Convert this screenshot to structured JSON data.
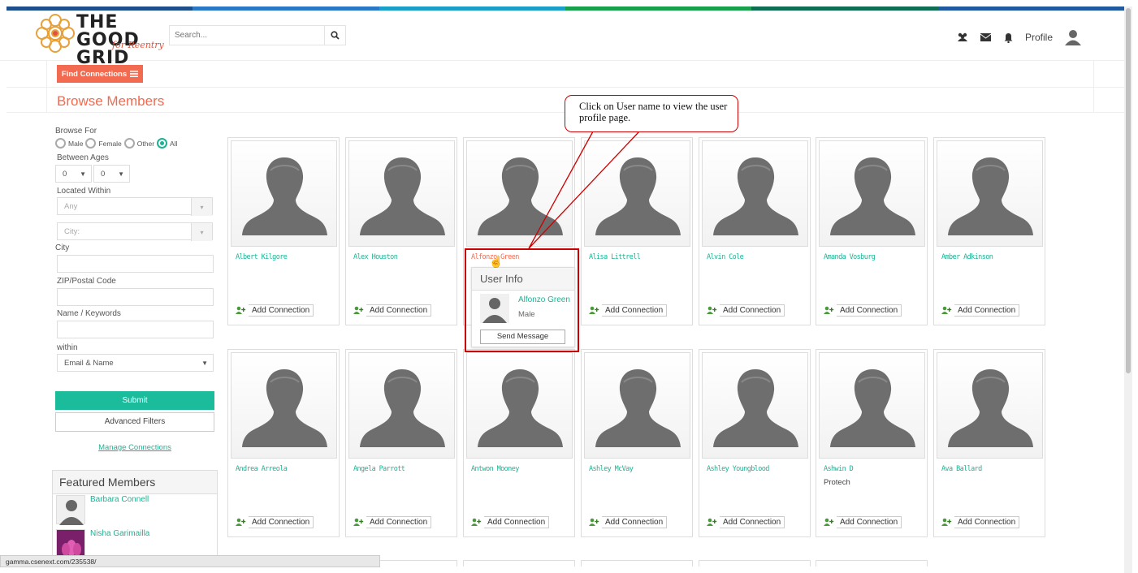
{
  "header": {
    "logo_line1": "THE GOOD",
    "logo_line2": "GRID",
    "logo_sub": "for Reentry",
    "search_placeholder": "Search...",
    "icons": [
      "users-icon",
      "envelope-icon",
      "bell-icon"
    ],
    "profile_label": "Profile"
  },
  "toolbar": {
    "find_connections": "Find Connections"
  },
  "page_title": "Browse Members",
  "filters": {
    "browse_for_label": "Browse For",
    "genders": [
      "Male",
      "Female",
      "Other",
      "All"
    ],
    "selected_gender": "All",
    "between_ages_label": "Between Ages",
    "age_from": "0",
    "age_to": "0",
    "located_within_label": "Located Within",
    "located_value": "Any",
    "city_select": "City:",
    "city_label": "City",
    "zip_label": "ZIP/Postal Code",
    "name_label": "Name / Keywords",
    "within_label": "within",
    "within_value": "Email & Name",
    "submit": "Submit",
    "advanced": "Advanced Filters",
    "manage": "Manage Connections"
  },
  "featured": {
    "title": "Featured Members",
    "members": [
      "Barbara Connell",
      "Nisha Garimailla"
    ]
  },
  "members": [
    {
      "name": "Albert Kilgore",
      "sub": ""
    },
    {
      "name": "Alex Houston",
      "sub": ""
    },
    {
      "name": "Alfonzo Green",
      "sub": ""
    },
    {
      "name": "Alisa Littrell",
      "sub": ""
    },
    {
      "name": "Alvin Cole",
      "sub": ""
    },
    {
      "name": "Amanda Vosburg",
      "sub": ""
    },
    {
      "name": "Amber Adkinson",
      "sub": ""
    },
    {
      "name": "Andrea Arreola",
      "sub": ""
    },
    {
      "name": "Angela Parrott",
      "sub": ""
    },
    {
      "name": "Antwon Mooney",
      "sub": ""
    },
    {
      "name": "Ashley McVay",
      "sub": ""
    },
    {
      "name": "Ashley Youngblood",
      "sub": ""
    },
    {
      "name": "Ashwin D",
      "sub": "Protech"
    },
    {
      "name": "Ava Ballard",
      "sub": ""
    }
  ],
  "add_connection_label": "Add Connection",
  "popup": {
    "title": "User Info",
    "name": "Alfonzo Green",
    "gender": "Male",
    "send": "Send Message"
  },
  "callout": "Click on User name to view the user profile page.",
  "status_url": "gamma.csenext.com/235538/",
  "colors": {
    "accent": "#f26a4f",
    "teal": "#1ab394",
    "highlight": "#cc0000"
  }
}
